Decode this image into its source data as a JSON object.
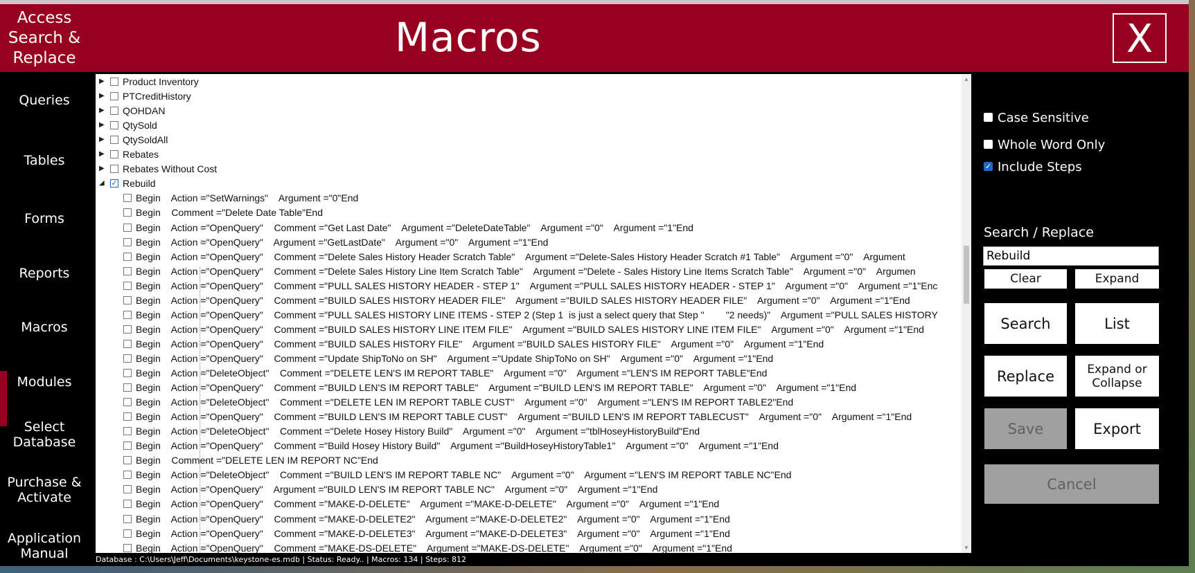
{
  "header": {
    "app_name_lines": [
      "Access",
      "Search &",
      "Replace"
    ],
    "title": "Macros",
    "close_label": "X"
  },
  "nav": {
    "items": [
      {
        "label": "Queries",
        "active": false
      },
      {
        "label": "Tables",
        "active": false
      },
      {
        "label": "Forms",
        "active": false
      },
      {
        "label": "Reports",
        "active": false
      },
      {
        "label": "Macros",
        "active": true
      },
      {
        "label": "Modules",
        "active": false
      },
      {
        "label": "Select\nDatabase",
        "active": false
      },
      {
        "label": "Purchase &\nActivate",
        "active": false
      },
      {
        "label": "Application\nManual",
        "active": false
      }
    ]
  },
  "tree": {
    "macros": [
      {
        "name": "Product Inventory",
        "checked": false,
        "expanded": false
      },
      {
        "name": "PTCreditHistory",
        "checked": false,
        "expanded": false
      },
      {
        "name": "QOHDAN",
        "checked": false,
        "expanded": false
      },
      {
        "name": "QtySold",
        "checked": false,
        "expanded": false
      },
      {
        "name": "QtySoldAll",
        "checked": false,
        "expanded": false
      },
      {
        "name": "Rebates",
        "checked": false,
        "expanded": false
      },
      {
        "name": "Rebates Without Cost",
        "checked": false,
        "expanded": false
      },
      {
        "name": "Rebuild",
        "checked": true,
        "expanded": true
      }
    ],
    "steps": [
      "Begin    Action =\"SetWarnings\"    Argument =\"0\"End",
      "Begin    Comment =\"Delete Date Table\"End",
      "Begin    Action =\"OpenQuery\"    Comment =\"Get Last Date\"    Argument =\"DeleteDateTable\"    Argument =\"0\"    Argument =\"1\"End",
      "Begin    Action =\"OpenQuery\"    Argument =\"GetLastDate\"    Argument =\"0\"    Argument =\"1\"End",
      "Begin    Action =\"OpenQuery\"    Comment =\"Delete Sales History Header Scratch Table\"    Argument =\"Delete-Sales History Header Scratch #1 Table\"    Argument =\"0\"    Argument",
      "Begin    Action =\"OpenQuery\"    Comment =\"Delete Sales History Line Item Scratch Table\"    Argument =\"Delete - Sales History Line Items Scratch Table\"    Argument =\"0\"    Argumen",
      "Begin    Action =\"OpenQuery\"    Comment =\"PULL SALES HISTORY HEADER - STEP 1\"    Argument =\"PULL SALES HISTORY HEADER - STEP 1\"    Argument =\"0\"    Argument =\"1\"Enc",
      "Begin    Action =\"OpenQuery\"    Comment =\"BUILD SALES HISTORY HEADER FILE\"    Argument =\"BUILD SALES HISTORY HEADER FILE\"    Argument =\"0\"    Argument =\"1\"End",
      "Begin    Action =\"OpenQuery\"    Comment =\"PULL SALES HISTORY LINE ITEMS - STEP 2 (Step 1  is just a select query that Step \"        \"2 needs)\"    Argument =\"PULL SALES HISTORY",
      "Begin    Action =\"OpenQuery\"    Comment =\"BUILD SALES HISTORY LINE ITEM FILE\"    Argument =\"BUILD SALES HISTORY LINE ITEM FILE\"    Argument =\"0\"    Argument =\"1\"End",
      "Begin    Action =\"OpenQuery\"    Comment =\"BUILD SALES HISTORY FILE\"    Argument =\"BUILD SALES HISTORY FILE\"    Argument =\"0\"    Argument =\"1\"End",
      "Begin    Action =\"OpenQuery\"    Comment =\"Update ShipToNo on SH\"    Argument =\"Update ShipToNo on SH\"    Argument =\"0\"    Argument =\"1\"End",
      "Begin    Action =\"DeleteObject\"    Comment =\"DELETE LEN'S IM REPORT TABLE\"    Argument =\"0\"    Argument =\"LEN'S IM REPORT TABLE\"End",
      "Begin    Action =\"OpenQuery\"    Comment =\"BUILD LEN'S IM REPORT TABLE\"    Argument =\"BUILD LEN'S IM REPORT TABLE\"    Argument =\"0\"    Argument =\"1\"End",
      "Begin    Action =\"DeleteObject\"    Comment =\"DELETE LEN IM REPORT TABLE CUST\"    Argument =\"0\"    Argument =\"LEN'S IM REPORT TABLE2\"End",
      "Begin    Action =\"OpenQuery\"    Comment =\"BUILD LEN'S IM REPORT TABLE CUST\"    Argument =\"BUILD LEN'S IM REPORT TABLECUST\"    Argument =\"0\"    Argument =\"1\"End",
      "Begin    Action =\"DeleteObject\"    Comment =\"Delete Hosey History Build\"    Argument =\"0\"    Argument =\"tblHoseyHistoryBuild\"End",
      "Begin    Action =\"OpenQuery\"    Comment =\"Build Hosey History Build\"    Argument =\"BuildHoseyHistoryTable1\"    Argument =\"0\"    Argument =\"1\"End",
      "Begin    Comment =\"DELETE LEN IM REPORT NC\"End",
      "Begin    Action =\"DeleteObject\"    Comment =\"BUILD LEN'S IM REPORT TABLE NC\"    Argument =\"0\"    Argument =\"LEN'S IM REPORT TABLE NC\"End",
      "Begin    Action =\"OpenQuery\"    Argument =\"BUILD LEN'S IM REPORT TABLE NC\"    Argument =\"0\"    Argument =\"1\"End",
      "Begin    Action =\"OpenQuery\"    Comment =\"MAKE-D-DELETE\"    Argument =\"MAKE-D-DELETE\"    Argument =\"0\"    Argument =\"1\"End",
      "Begin    Action =\"OpenQuery\"    Comment =\"MAKE-D-DELETE2\"    Argument =\"MAKE-D-DELETE2\"    Argument =\"0\"    Argument =\"1\"End",
      "Begin    Action =\"OpenQuery\"    Comment =\"MAKE-D-DELETE3\"    Argument =\"MAKE-D-DELETE3\"    Argument =\"0\"    Argument =\"1\"End",
      "Begin    Action =\"OpenQuery\"    Comment =\"MAKE-DS-DELETE\"    Argument =\"MAKE-DS-DELETE\"    Argument =\"0\"    Argument =\"1\"End"
    ]
  },
  "options": {
    "case_sensitive": {
      "label": "Case Sensitive",
      "checked": false
    },
    "whole_word_only": {
      "label": "Whole Word Only",
      "checked": false
    },
    "include_steps": {
      "label": "Include Steps",
      "checked": true
    }
  },
  "search": {
    "label": "Search / Replace",
    "value": "Rebuild"
  },
  "buttons": {
    "clear": "Clear",
    "expand": "Expand",
    "search": "Search",
    "list": "List",
    "replace": "Replace",
    "expand_or_collapse_line1": "Expand or",
    "expand_or_collapse_line2": "Collapse",
    "save": "Save",
    "export": "Export",
    "cancel": "Cancel"
  },
  "status": "Database : C:\\Users\\Jeff\\Documents\\keystone-es.mdb  |  Status: Ready..  |  Macros: 134 | Steps: 812",
  "colors": {
    "brand": "#98001f",
    "checkbox_accent": "#1b6ac9"
  },
  "icons": {
    "expand_arrow": "caret-right-icon",
    "collapse_arrow": "caret-down-icon",
    "close": "close-icon"
  }
}
